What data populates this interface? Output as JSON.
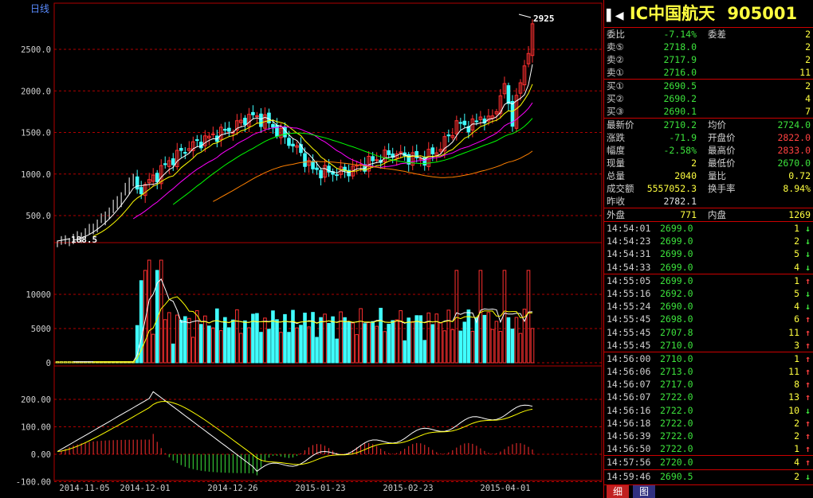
{
  "chart": {
    "period_label": "日线",
    "price_high_label": "2925",
    "price_low_label": "188.5",
    "price_ticks": [
      "2500.0",
      "2000.0",
      "1500.0",
      "1000.0",
      "500.0"
    ],
    "volume_ticks": [
      "10000",
      "5000",
      "0"
    ],
    "macd_ticks": [
      "200.00",
      "100.00",
      "0.00",
      "-100.00"
    ],
    "date_ticks": [
      "2014-11-05",
      "2014-12-01",
      "2014-12-26",
      "2015-01-23",
      "2015-02-23",
      "2015-04-01"
    ],
    "colors": {
      "up": "#ff3030",
      "down": "#40ffff",
      "grid": "#b00000",
      "ma5": "#ffffff",
      "ma10": "#ffff00",
      "ma20": "#ff00ff",
      "ma60": "#00ff00",
      "ma120": "#ff8000"
    }
  },
  "chart_data": {
    "type": "line",
    "price_axis": [
      500,
      1000,
      1500,
      2000,
      2500
    ],
    "highest": 2925,
    "lowest": 188.5,
    "volume_axis": [
      0,
      5000,
      10000
    ],
    "macd_axis": [
      -100,
      0,
      100,
      200
    ],
    "x_dates": [
      "2014-11-05",
      "2014-12-01",
      "2014-12-26",
      "2015-01-23",
      "2015-02-23",
      "2015-04-01"
    ]
  },
  "quote": {
    "name": "IC中国航天",
    "code": "905001",
    "arrow_left": "▌◀",
    "webi_label": "委比",
    "webi_value": "-7.14%",
    "weicha_label": "委差",
    "weicha_value": "2",
    "asks": [
      {
        "label": "卖⑤",
        "price": "2718.0",
        "vol": "2"
      },
      {
        "label": "卖②",
        "price": "2717.9",
        "vol": "2"
      },
      {
        "label": "卖①",
        "price": "2716.0",
        "vol": "11"
      }
    ],
    "bids": [
      {
        "label": "买①",
        "price": "2690.5",
        "vol": "2"
      },
      {
        "label": "买②",
        "price": "2690.2",
        "vol": "4"
      },
      {
        "label": "买③",
        "price": "2690.1",
        "vol": "7"
      }
    ],
    "stats": [
      {
        "l1": "最新价",
        "v1": "2710.2",
        "l2": "均价",
        "v2": "2724.0"
      },
      {
        "l1": "涨跌",
        "v1": "-71.9",
        "l2": "开盘价",
        "v2": "2822.0"
      },
      {
        "l1": "幅度",
        "v1": "-2.58%",
        "l2": "最高价",
        "v2": "2833.0"
      },
      {
        "l1": "现量",
        "v1": "2",
        "l2": "最低价",
        "v2": "2670.0"
      },
      {
        "l1": "总量",
        "v1": "2040",
        "l2": "量比",
        "v2": "0.72"
      },
      {
        "l1": "成交额",
        "v1": "5557052.3",
        "l2": "换手率",
        "v2": "8.94%"
      },
      {
        "l1": "昨收",
        "v1": "2782.1",
        "l2": "",
        "v2": ""
      }
    ],
    "waipan_label": "外盘",
    "waipan_value": "771",
    "neipan_label": "内盘",
    "neipan_value": "1269",
    "ticks": [
      {
        "time": "14:54:01",
        "price": "2699.0",
        "vol": "1",
        "dir": "↓"
      },
      {
        "time": "14:54:23",
        "price": "2699.0",
        "vol": "2",
        "dir": "↓"
      },
      {
        "time": "14:54:31",
        "price": "2699.0",
        "vol": "5",
        "dir": "↓"
      },
      {
        "time": "14:54:33",
        "price": "2699.0",
        "vol": "4",
        "dir": "↓"
      },
      {
        "time": "14:55:05",
        "price": "2699.0",
        "vol": "1",
        "dir": "↑"
      },
      {
        "time": "14:55:16",
        "price": "2692.0",
        "vol": "5",
        "dir": "↓"
      },
      {
        "time": "14:55:24",
        "price": "2690.0",
        "vol": "4",
        "dir": "↓"
      },
      {
        "time": "14:55:45",
        "price": "2698.0",
        "vol": "6",
        "dir": "↑"
      },
      {
        "time": "14:55:45",
        "price": "2707.8",
        "vol": "11",
        "dir": "↑"
      },
      {
        "time": "14:55:45",
        "price": "2710.0",
        "vol": "3",
        "dir": "↑"
      },
      {
        "time": "14:56:00",
        "price": "2710.0",
        "vol": "1",
        "dir": "↑"
      },
      {
        "time": "14:56:06",
        "price": "2713.0",
        "vol": "11",
        "dir": "↑"
      },
      {
        "time": "14:56:07",
        "price": "2717.0",
        "vol": "8",
        "dir": "↑"
      },
      {
        "time": "14:56:07",
        "price": "2722.0",
        "vol": "13",
        "dir": "↑"
      },
      {
        "time": "14:56:16",
        "price": "2722.0",
        "vol": "10",
        "dir": "↓"
      },
      {
        "time": "14:56:18",
        "price": "2722.0",
        "vol": "2",
        "dir": "↑"
      },
      {
        "time": "14:56:39",
        "price": "2722.0",
        "vol": "2",
        "dir": "↑"
      },
      {
        "time": "14:56:50",
        "price": "2722.0",
        "vol": "1",
        "dir": "↑"
      },
      {
        "time": "14:57:56",
        "price": "2720.0",
        "vol": "4",
        "dir": "↑"
      },
      {
        "time": "14:59:46",
        "price": "2690.5",
        "vol": "2",
        "dir": "↓"
      }
    ],
    "tab1": "细",
    "tab2": "图"
  }
}
